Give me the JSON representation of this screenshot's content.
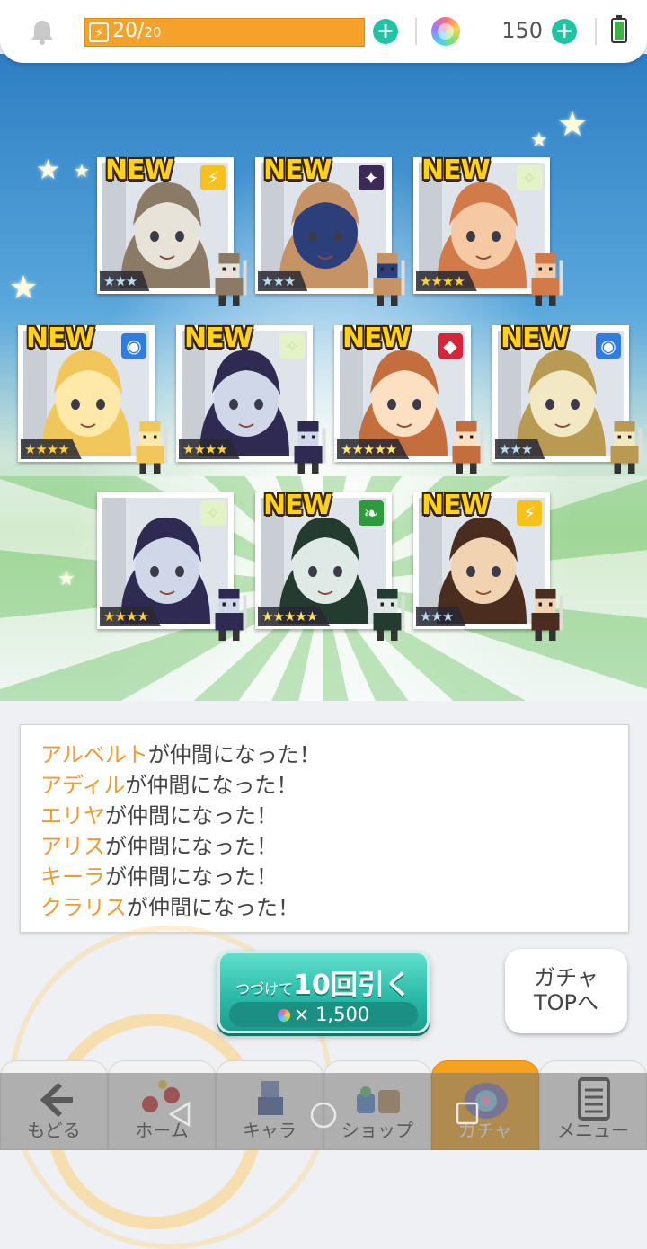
{
  "status": {
    "stamina_current": "20",
    "stamina_max": "20",
    "stamina_sep": "/",
    "stamina_fill_fraction": 1.0,
    "gems": "150",
    "icons": [
      "bell-icon",
      "lightning-icon",
      "plus-icon",
      "rainbow-gem-icon",
      "battery-icon"
    ]
  },
  "cards": [
    {
      "row": 1,
      "new": "NEW",
      "attr": "⚡",
      "attr_color": "#f5c11a",
      "rarity": "★★★",
      "rarity_tier": "silver",
      "portrait_colors": [
        "#e8e3d8",
        "#8b7a66"
      ]
    },
    {
      "row": 1,
      "new": "NEW",
      "attr": "✦",
      "attr_color": "#3b2a55",
      "rarity": "★★★",
      "rarity_tier": "silver",
      "portrait_colors": [
        "#2d3f7a",
        "#c59366"
      ]
    },
    {
      "row": 1,
      "new": "NEW",
      "attr": "✧",
      "attr_color": "#e3f2c7",
      "rarity": "★★★★",
      "rarity_tier": "gold",
      "portrait_colors": [
        "#f5c9a3",
        "#d27a4a"
      ]
    },
    {
      "row": 2,
      "new": "NEW",
      "attr": "◉",
      "attr_color": "#2f7de0",
      "rarity": "★★★★",
      "rarity_tier": "gold",
      "portrait_colors": [
        "#ffe9a8",
        "#f1c65a"
      ]
    },
    {
      "row": 2,
      "new": "NEW",
      "attr": "✧",
      "attr_color": "#e3f2c7",
      "rarity": "★★★★",
      "rarity_tier": "gold",
      "portrait_colors": [
        "#cfd7e8",
        "#2e2a52"
      ]
    },
    {
      "row": 2,
      "new": "NEW",
      "attr": "◆",
      "attr_color": "#d6253a",
      "rarity": "★★★★★",
      "rarity_tier": "rainbow",
      "portrait_colors": [
        "#fde0c2",
        "#c46d3d"
      ]
    },
    {
      "row": 2,
      "new": "NEW",
      "attr": "◉",
      "attr_color": "#2f7de0",
      "rarity": "★★★",
      "rarity_tier": "silver",
      "portrait_colors": [
        "#f2e8c4",
        "#b89a52"
      ]
    },
    {
      "row": 3,
      "new": "",
      "attr": "✧",
      "attr_color": "#e3f2c7",
      "rarity": "★★★★",
      "rarity_tier": "gold",
      "portrait_colors": [
        "#cfd7e8",
        "#2e2a52"
      ]
    },
    {
      "row": 3,
      "new": "NEW",
      "attr": "❧",
      "attr_color": "#2f9a3c",
      "rarity": "★★★★★",
      "rarity_tier": "rainbow",
      "portrait_colors": [
        "#dfe9e6",
        "#243b30"
      ]
    },
    {
      "row": 3,
      "new": "NEW",
      "attr": "⚡",
      "attr_color": "#f5c11a",
      "rarity": "★★★",
      "rarity_tier": "silver",
      "portrait_colors": [
        "#f1d2b1",
        "#4a2d1e"
      ]
    }
  ],
  "messages": [
    {
      "name": "アルベルト",
      "suffix": "が仲間になった！"
    },
    {
      "name": "アディル",
      "suffix": "が仲間になった！"
    },
    {
      "name": "エリヤ",
      "suffix": "が仲間になった！"
    },
    {
      "name": "アリス",
      "suffix": "が仲間になった！"
    },
    {
      "name": "キーラ",
      "suffix": "が仲間になった！"
    },
    {
      "name": "クラリス",
      "suffix": "が仲間になった！"
    }
  ],
  "pull_button": {
    "prefix": "つづけて",
    "main": "10回引く",
    "cost": "× 1,500"
  },
  "gacha_top_button": {
    "line1": "ガチャ",
    "line2": "TOPへ"
  },
  "nav": [
    {
      "label": "もどる",
      "icon": "back-arrow-icon",
      "active": false
    },
    {
      "label": "ホーム",
      "icon": "home-icon",
      "active": false
    },
    {
      "label": "キャラ",
      "icon": "character-icon",
      "active": false
    },
    {
      "label": "ショップ",
      "icon": "shop-icon",
      "active": false
    },
    {
      "label": "ガチャ",
      "icon": "gacha-icon",
      "active": true
    },
    {
      "label": "メニュー",
      "icon": "menu-icon",
      "active": false
    }
  ],
  "colors": {
    "accent_teal": "#21c3a5",
    "stamina_orange": "#f6a22a",
    "name_orange": "#f29a2e",
    "active_tab": "#f4a21f"
  }
}
